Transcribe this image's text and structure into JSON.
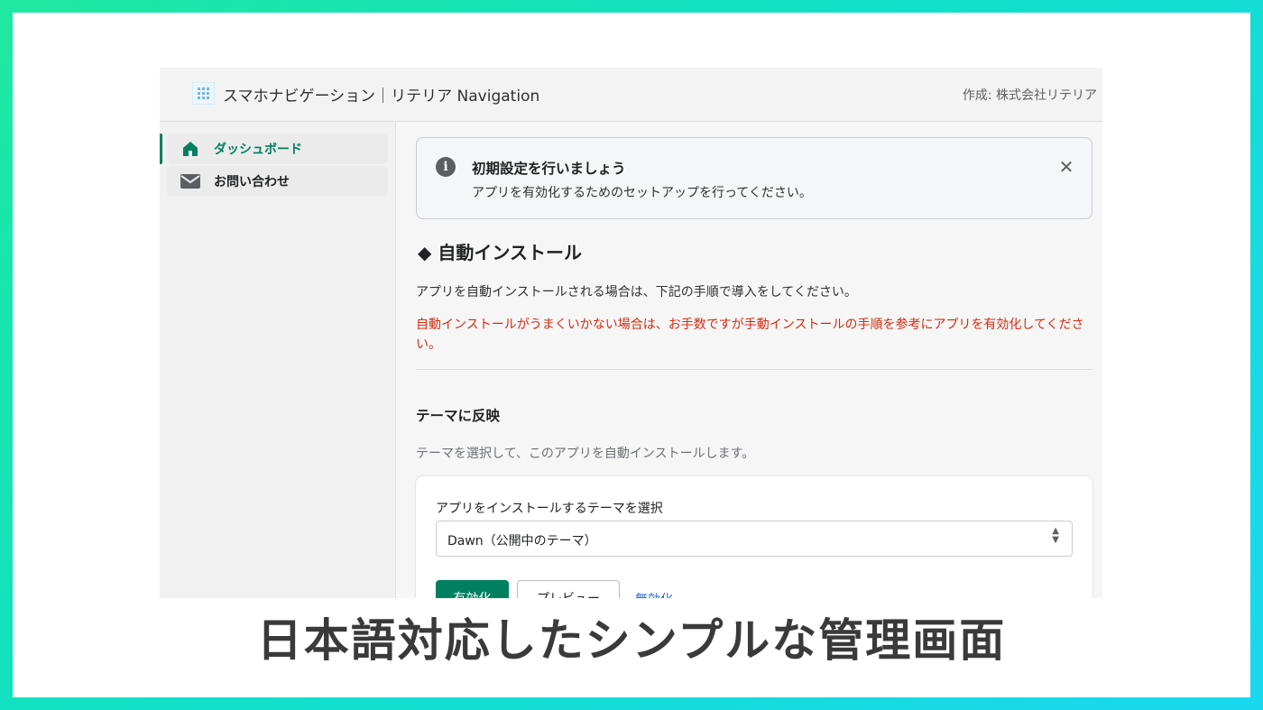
{
  "app": {
    "title": "スマホナビゲーション｜リテリア Navigation",
    "author": "作成: 株式会社リテリア",
    "logo_icon": "grid-logo-icon"
  },
  "sidebar": {
    "items": [
      {
        "label": "ダッシュボード",
        "icon": "home-icon",
        "active": true
      },
      {
        "label": "お問い合わせ",
        "icon": "mail-icon",
        "active": false
      }
    ]
  },
  "banner": {
    "icon": "info-icon",
    "title": "初期設定を行いましょう",
    "text": "アプリを有効化するためのセットアップを行ってください。",
    "close_icon": "close-icon"
  },
  "section": {
    "heading": "◆ 自動インストール",
    "description": "アプリを自動インストールされる場合は、下記の手順で導入をしてください。",
    "warning": "自動インストールがうまくいかない場合は、お手数ですが手動インストールの手順を参考にアプリを有効化してください。"
  },
  "theme": {
    "title": "テーマに反映",
    "description": "テーマを選択して、このアプリを自動インストールします。",
    "select_label": "アプリをインストールするテーマを選択",
    "select_value": "Dawn（公開中のテーマ）",
    "enable_button": "有効化",
    "preview_button": "プレビュー",
    "disable_link": "無効化"
  },
  "caption": "日本語対応したシンプルな管理画面",
  "colors": {
    "accent": "#008060",
    "warning": "#d82c0d",
    "link": "#2c6ecb"
  }
}
